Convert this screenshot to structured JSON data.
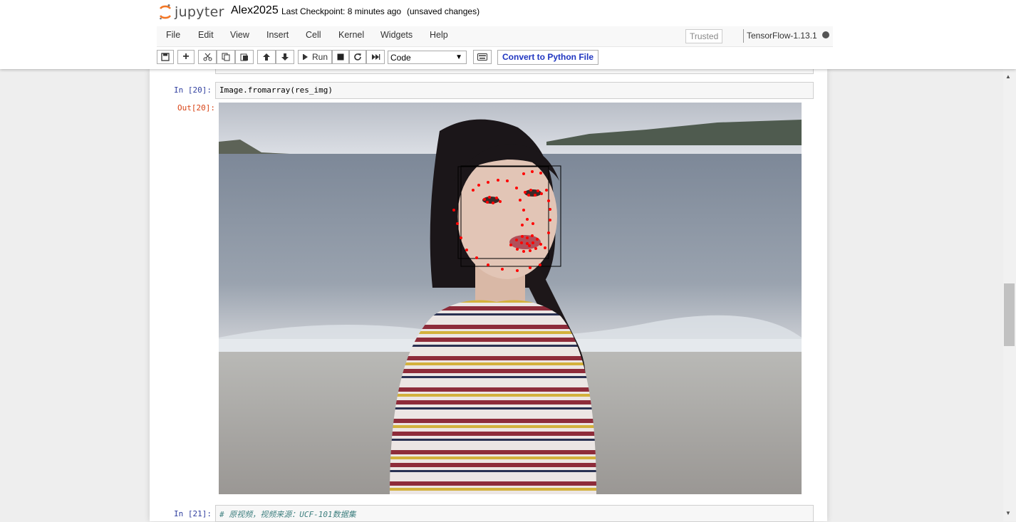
{
  "header": {
    "logo_text": "jupyter",
    "notebook_name": "Alex2025",
    "checkpoint": "Last Checkpoint: 8 minutes ago",
    "autosave": "(unsaved changes)"
  },
  "menu": {
    "items": [
      "File",
      "Edit",
      "View",
      "Insert",
      "Cell",
      "Kernel",
      "Widgets",
      "Help"
    ],
    "trusted": "Trusted",
    "kernel_name": "TensorFlow-1.13.1"
  },
  "toolbar": {
    "run_label": "Run",
    "cell_type": "Code",
    "convert_label": "Convert to Python File"
  },
  "cells": [
    {
      "prompt": "In  [20]:",
      "code": "Image.fromarray(res_img)",
      "out_prompt": "Out[20]:"
    },
    {
      "prompt": "In  [21]:",
      "code": "# 原视频，视频来源：UCF-101数据集"
    }
  ],
  "colors": {
    "logo_orange": "#f37726",
    "prompt_in": "#303f9f",
    "prompt_out": "#d84315",
    "landmark": "#ff0000",
    "convert_text": "#1f35c0"
  }
}
